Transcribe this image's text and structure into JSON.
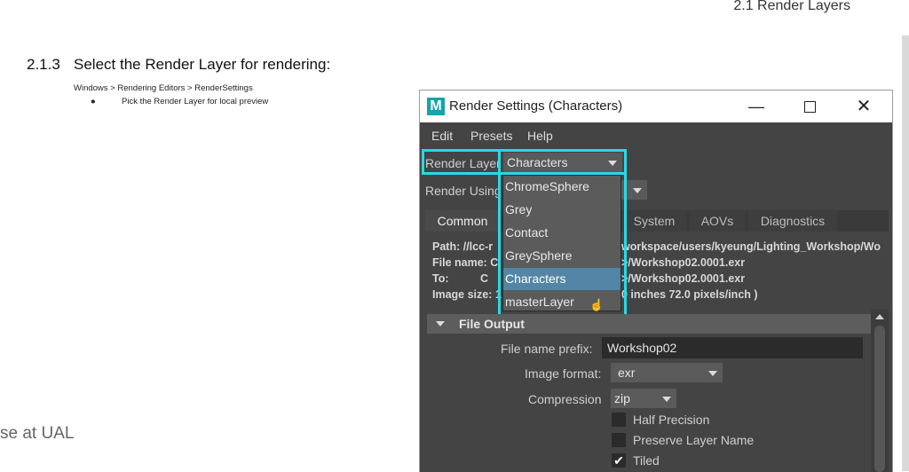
{
  "document": {
    "header": "2.1 Render Layers",
    "section_number": "2.1.3",
    "section_title": "Select the Render Layer for rendering:",
    "menu_path": "Windows > Rendering Editors > RenderSettings",
    "bullet_marker": "●",
    "bullet": "Pick the Render Layer for local preview",
    "footer_fragment": "se at UAL"
  },
  "window": {
    "logo": "M",
    "title": "Render Settings (Characters)",
    "controls": {
      "minimize": "—",
      "close": "✕"
    },
    "menus": [
      "Edit",
      "Presets",
      "Help"
    ],
    "render_layer": {
      "label": "Render Layer",
      "value": "Characters"
    },
    "render_using": {
      "label": "Render Using"
    },
    "tabs": [
      "Common",
      "System",
      "AOVs",
      "Diagnostics"
    ],
    "info_lines": [
      {
        "key": "Path: //lcc-r",
        "value": "workspace/users/kyeung/Lighting_Workshop/Wo"
      },
      {
        "key": "File name:  C",
        "value": ">/Workshop02.0001.exr"
      },
      {
        "key": "To:",
        "mid": "C",
        "value": ">/Workshop02.0001.exr"
      },
      {
        "key": "Image size: 1",
        "value": "0 inches 72.0 pixels/inch )"
      }
    ],
    "layer_options": [
      "ChromeSphere",
      "Grey",
      "Contact",
      "GreySphere",
      "Characters",
      "masterLayer"
    ],
    "selected_layer": "Characters",
    "file_output": {
      "section_title": "File Output",
      "prefix_label": "File name prefix:",
      "prefix_value": "Workshop02",
      "format_label": "Image format:",
      "format_value": "exr",
      "compression_label": "Compression",
      "compression_value": "zip",
      "checkboxes": [
        {
          "label": "Half Precision",
          "checked": false
        },
        {
          "label": "Preserve Layer Name",
          "checked": false
        },
        {
          "label": "Tiled",
          "checked": true
        }
      ]
    },
    "highlight_color": "#27d9e6"
  }
}
